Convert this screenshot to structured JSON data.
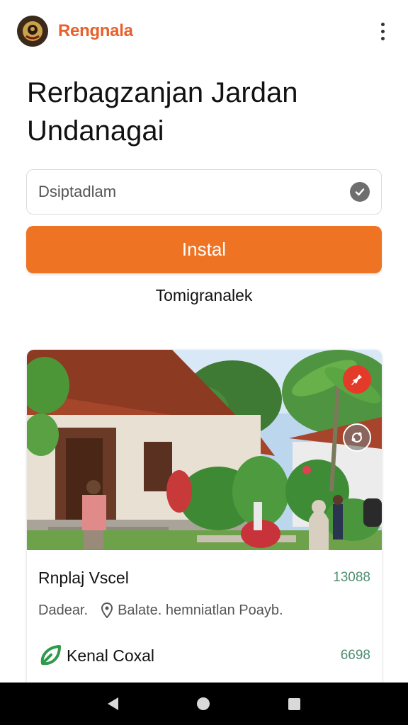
{
  "app": {
    "brand": "Rengnala"
  },
  "page": {
    "title": "Rerbagzanjan Jardan Undanagai",
    "input_value": "Dsiptadlam",
    "install_label": "Instal",
    "secondary_link": "Tomigranalek"
  },
  "card": {
    "title": "Rnplaj Vscel",
    "count": "13088",
    "meta_label": "Dadear.",
    "location": "Balate. hemniatlan Poayb.",
    "tag": "Kenal Coxal",
    "tag_count": "6698"
  },
  "icons": {
    "menu": "more-vert-icon",
    "input_check": "check-circle-icon",
    "fab_red": "pin-icon",
    "fab_grey": "share-icon",
    "location": "location-pin-icon",
    "tag": "leaf-icon"
  },
  "colors": {
    "accent": "#ee7424",
    "brand_text": "#e8602a",
    "fab_red": "#e43a2a",
    "count_text": "#4e8e72"
  }
}
